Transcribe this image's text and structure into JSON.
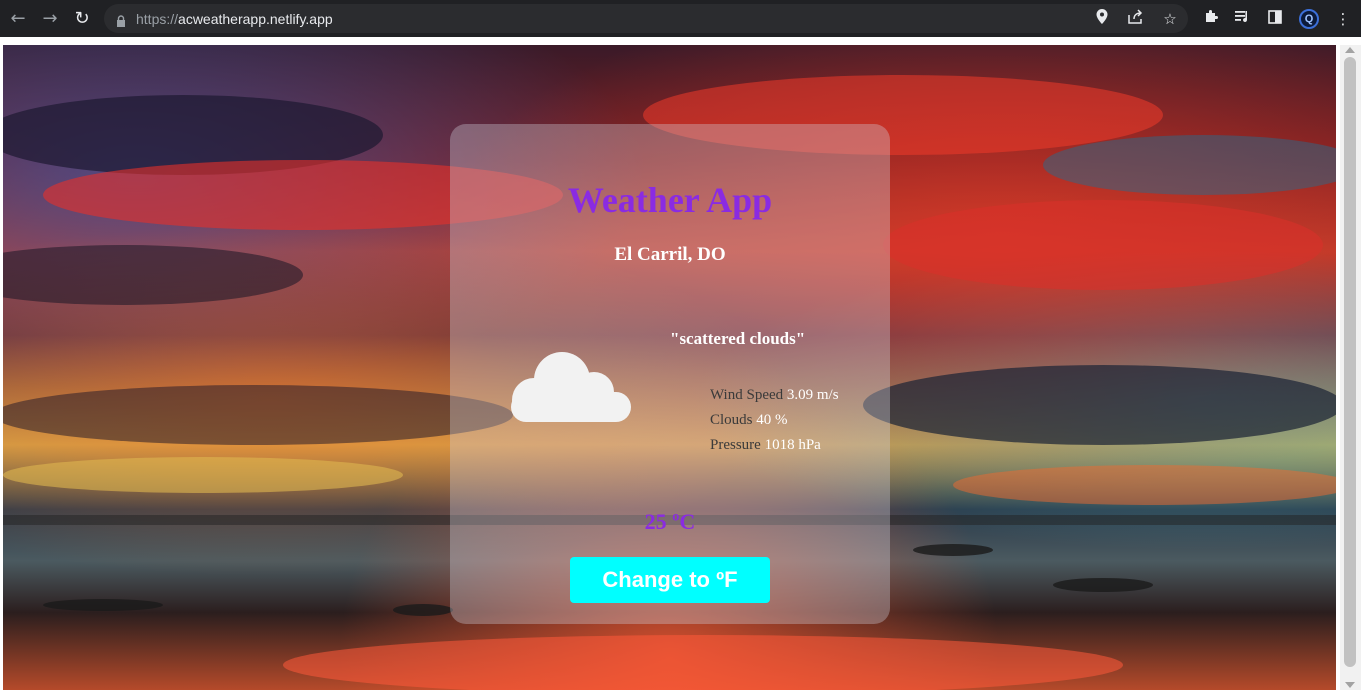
{
  "browser": {
    "url_scheme": "https://",
    "url_host": "acweatherapp.netlify.app",
    "avatar_letter": "Q"
  },
  "app": {
    "title": "Weather App",
    "city": "El Carril, DO",
    "description": "\"scattered clouds\"",
    "weather_icon": "cloud-icon",
    "stats": [
      {
        "label": "Wind Speed",
        "value": "3.09 m/s"
      },
      {
        "label": "Clouds",
        "value": "40 %"
      },
      {
        "label": "Pressure",
        "value": "1018 hPa"
      }
    ],
    "temperature": "25 ºC",
    "change_button": "Change to ºF"
  },
  "colors": {
    "accent": "#8a2be2",
    "button": "#00ffff",
    "chrome_bg": "#202124"
  }
}
